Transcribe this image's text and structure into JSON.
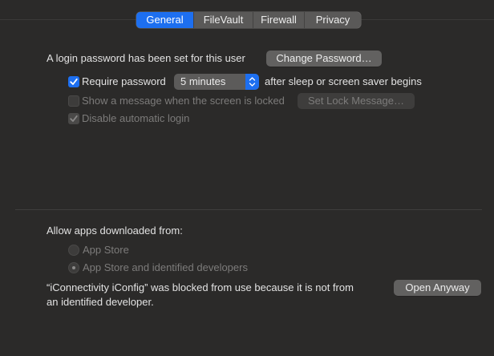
{
  "tabs": [
    {
      "label": "General",
      "selected": true
    },
    {
      "label": "FileVault",
      "selected": false
    },
    {
      "label": "Firewall",
      "selected": false
    },
    {
      "label": "Privacy",
      "selected": false
    }
  ],
  "login": {
    "label": "A login password has been set for this user",
    "change_button": "Change Password…"
  },
  "require_password": {
    "label": "Require password",
    "checked": true,
    "select_value": "5 minutes",
    "suffix": "after sleep or screen saver begins"
  },
  "show_message": {
    "label": "Show a message when the screen is locked",
    "checked": false,
    "enabled": false,
    "button": "Set Lock Message…"
  },
  "disable_auto_login": {
    "label": "Disable automatic login",
    "checked": true,
    "enabled": false
  },
  "allow_apps": {
    "label": "Allow apps downloaded from:",
    "options": [
      {
        "label": "App Store",
        "selected": false
      },
      {
        "label": "App Store and identified developers",
        "selected": true
      }
    ]
  },
  "blocked": {
    "line1": "“iConnectivity iConfig” was blocked from use because it is not from",
    "line2": "an identified developer.",
    "button": "Open Anyway"
  },
  "colors": {
    "background": "#2b2a29",
    "accent": "#1d6ff0",
    "text": "#e2e2e2",
    "disabled_text": "#7c7b7a"
  }
}
